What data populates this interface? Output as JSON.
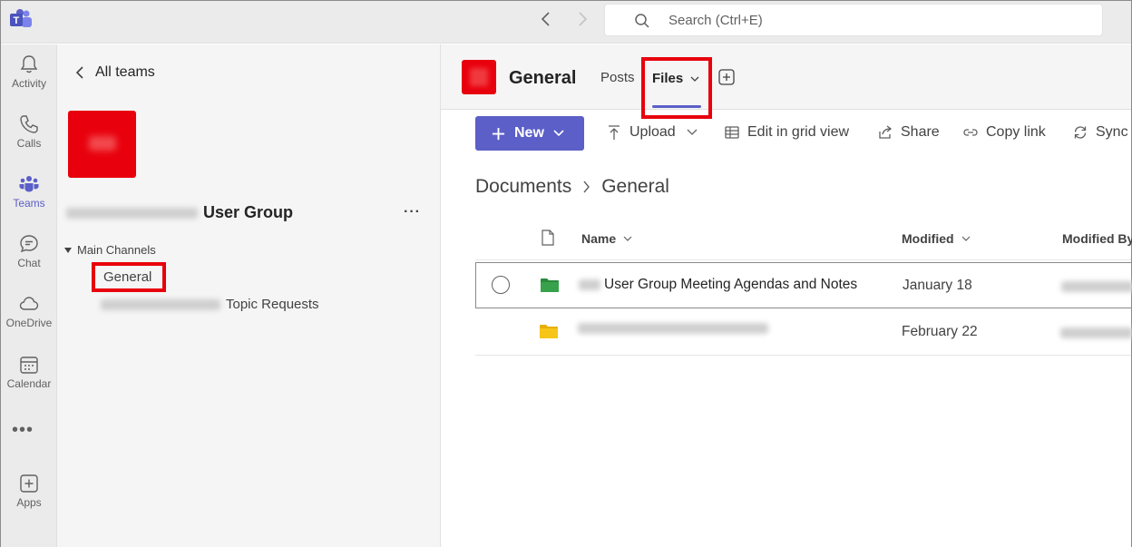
{
  "topbar": {
    "search_placeholder": "Search (Ctrl+E)",
    "icons": [
      "teams-logo",
      "back-arrow",
      "forward-arrow",
      "search"
    ]
  },
  "rail": {
    "items": [
      {
        "label": "Activity",
        "icon": "bell",
        "active": false
      },
      {
        "label": "Calls",
        "icon": "phone",
        "active": false
      },
      {
        "label": "Teams",
        "icon": "people",
        "active": true
      },
      {
        "label": "Chat",
        "icon": "chat-bubble",
        "active": false
      },
      {
        "label": "OneDrive",
        "icon": "cloud",
        "active": false
      },
      {
        "label": "Calendar",
        "icon": "calendar",
        "active": false
      },
      {
        "label": "Apps",
        "icon": "plus-square",
        "active": false
      }
    ],
    "more_label": "•••"
  },
  "teams_panel": {
    "back_label": "All teams",
    "team_name": "User Group",
    "menu_label": "···",
    "section_label": "Main Channels",
    "channels": [
      {
        "label": "General",
        "selected": true
      },
      {
        "label": "Topic Requests",
        "selected": false
      }
    ]
  },
  "channel": {
    "title": "General",
    "tabs": [
      {
        "label": "Posts",
        "active": false
      },
      {
        "label": "Files",
        "active": true
      }
    ]
  },
  "toolbar": {
    "new_label": "New",
    "upload_label": "Upload",
    "grid_label": "Edit in grid view",
    "share_label": "Share",
    "copy_link_label": "Copy link",
    "sync_label": "Sync"
  },
  "breadcrumb": {
    "root": "Documents",
    "current": "General"
  },
  "file_list": {
    "columns": {
      "name": "Name",
      "modified": "Modified",
      "modified_by": "Modified By"
    },
    "rows": [
      {
        "name": "User Group Meeting Agendas and Notes",
        "modified": "January 18",
        "folder_color": "#2b8a3e",
        "selected": true
      },
      {
        "name": "",
        "modified": "February 22",
        "folder_color": "#f5c518",
        "selected": false
      }
    ]
  },
  "colors": {
    "accent": "#5b5fc7",
    "highlight_box": "#e8000d",
    "team_avatar": "#e8000d"
  }
}
